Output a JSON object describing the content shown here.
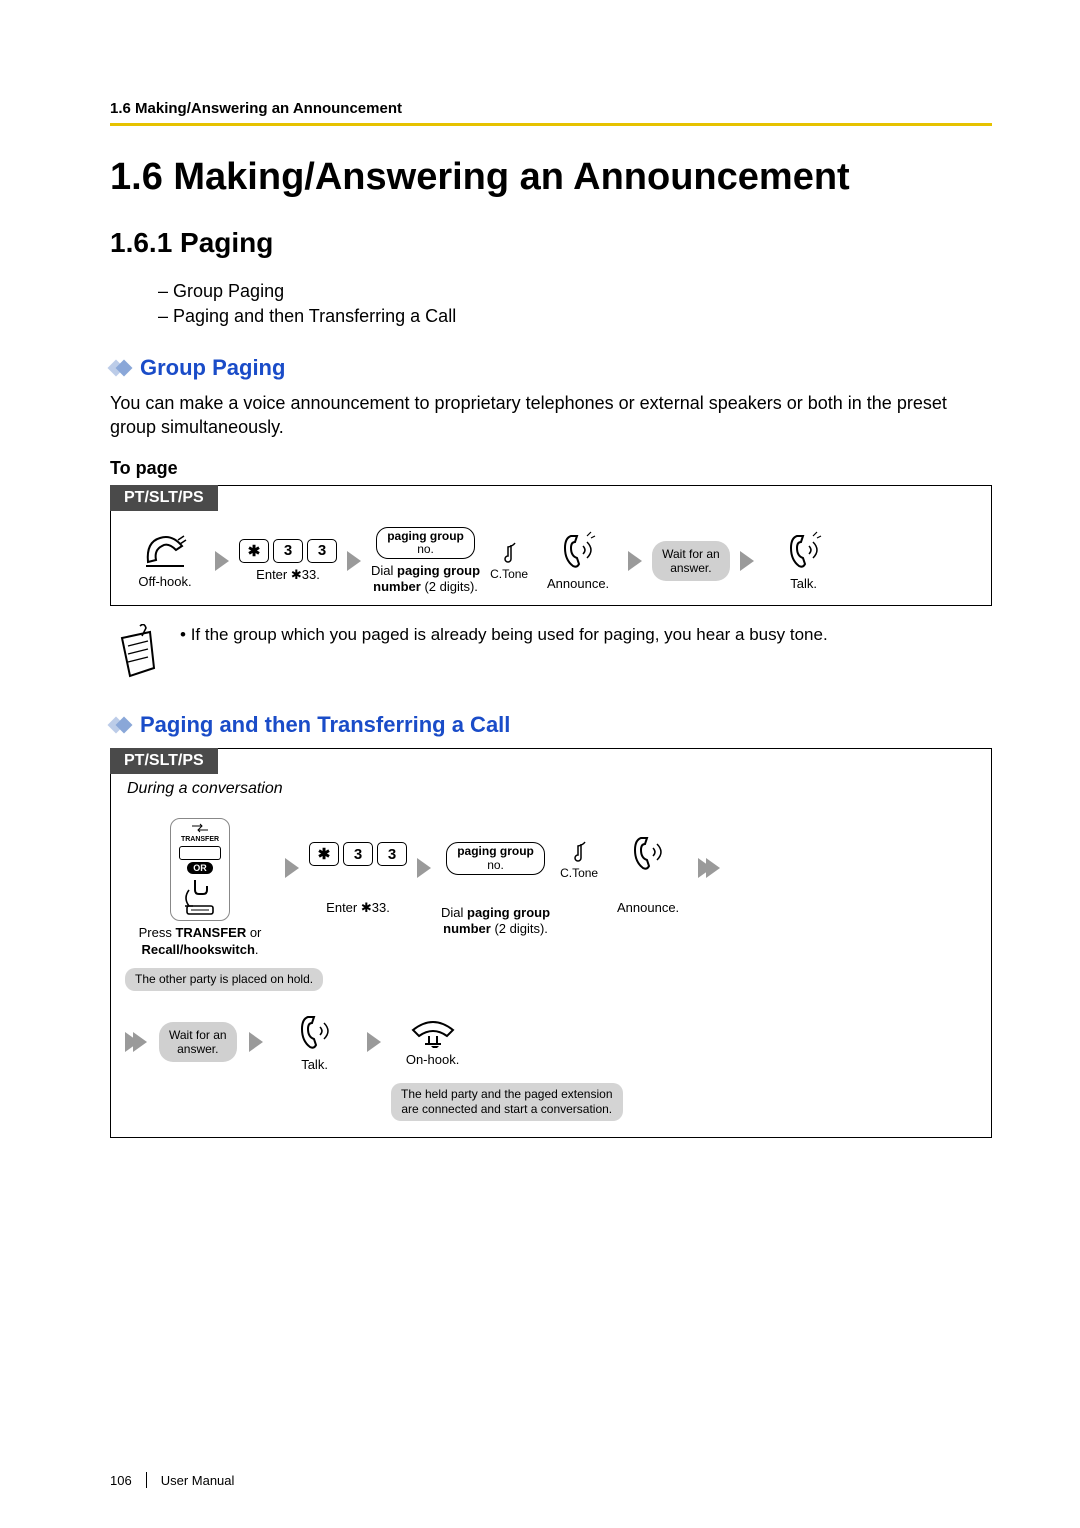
{
  "header": {
    "running": "1.6 Making/Answering an Announcement",
    "title": "1.6   Making/Answering an Announcement",
    "subtitle": "1.6.1   Paging"
  },
  "bullets": [
    "–   Group Paging",
    "–   Paging and then Transferring a Call"
  ],
  "sect1": {
    "title": "Group Paging",
    "para": "You can make a voice announcement to proprietary telephones or external speakers or both in the preset group simultaneously.",
    "subhead": "To page",
    "tab": "PT/SLT/PS",
    "steps": {
      "offhook": "Off-hook.",
      "keys": [
        "✱",
        "3",
        "3"
      ],
      "enter": "Enter ✱33.",
      "pill_l1": "paging group",
      "pill_l2": "no.",
      "dial_l1": "Dial paging group",
      "dial_l2": "number (2 digits).",
      "ctone": "C.Tone",
      "announce": "Announce.",
      "wait_l1": "Wait for an",
      "wait_l2": "answer.",
      "talk": "Talk."
    },
    "note": "If the group which you paged is already being used for paging, you hear a busy tone."
  },
  "sect2": {
    "title": "Paging and then Transferring a Call",
    "tab": "PT/SLT/PS",
    "during": "During a conversation",
    "transfer_label": "TRANSFER",
    "or": "OR",
    "press_l1": "Press TRANSFER or",
    "press_l2": "Recall/hookswitch.",
    "hold_callout": "The other party is placed on hold.",
    "keys": [
      "✱",
      "3",
      "3"
    ],
    "enter": "Enter ✱33.",
    "pill_l1": "paging group",
    "pill_l2": "no.",
    "dial_l1": "Dial paging group",
    "dial_l2": "number (2 digits).",
    "ctone": "C.Tone",
    "announce": "Announce.",
    "wait_l1": "Wait for an",
    "wait_l2": "answer.",
    "talk": "Talk.",
    "onhook": "On-hook.",
    "final_callout_l1": "The held party and the paged extension",
    "final_callout_l2": "are connected and start a conversation."
  },
  "footer": {
    "page": "106",
    "label": "User Manual"
  }
}
